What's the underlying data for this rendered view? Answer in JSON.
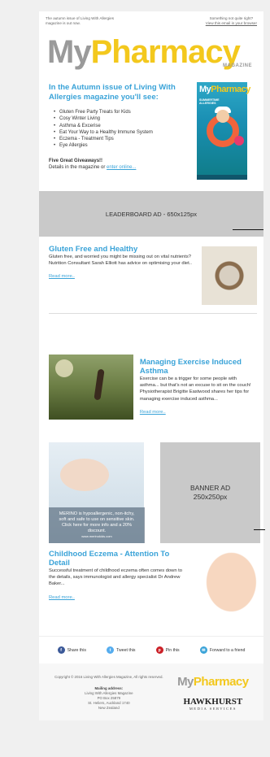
{
  "preheader": {
    "left": "The autumn issue of Living With Allergies magazine is out now.",
    "right_line1": "Something not quite right?",
    "right_link": "View this email in your browser"
  },
  "logo": {
    "my": "My",
    "pharmacy": "Pharmacy",
    "magazine": "MAGAZINE"
  },
  "intro": {
    "headline": "In the Autumn issue of Living With Allergies magazine you'll see:",
    "items": [
      "Gluten Free Party Treats for Kids",
      "Cosy Winter Living",
      "Asthma & Excerise",
      "Eat Your Way to a Healthy Immune System",
      "Eczema - Treatment Tips",
      "Eye Allergies"
    ],
    "giveaway_title": "Five Great Giveaways!!",
    "giveaway_text": "Details in the magazine or",
    "giveaway_link": "enter online..."
  },
  "cover": {
    "title_my": "My",
    "title_pharmacy": "Pharmacy",
    "subtitle": "SUMMERTIME ALLERGIES"
  },
  "leaderboard": {
    "label": "LEADERBOARD AD  -  650x125px"
  },
  "article1": {
    "title": "Gluten Free and Healthy",
    "body": "Gluten free, and worried you might be missing out on vital nutrients? Nutrition Consultant Sarah Elliott has advice on optimising your diet..",
    "link": "Read more.."
  },
  "article2": {
    "title": "Managing Exercise Induced Asthma",
    "body": "Exercise can be a trigger for some people with asthma... but that's not an excuse to sit on the couch! Physiotherapist Brigitte Eastwood shares her tips for managing exercise induced asthma...",
    "link": "Read more.."
  },
  "merino_ad": {
    "text": "MERINO is hypoallergenic, non-itchy, soft and safe to use on sensitive skin. Click here for more info and a 20% discount.",
    "url": "www.merinokids.com"
  },
  "banner": {
    "line1": "BANNER AD",
    "line2": "250x250px"
  },
  "article3": {
    "title": "Childhood Eczema - Attention To Detail",
    "body": "Successful treatment of childhood eczema often comes down to the details, says immunologist and allergy specialist Dr Andrew Baker...",
    "link": "Read more.."
  },
  "share": [
    {
      "label": "Share this",
      "icon": "facebook-icon",
      "color": "#3b5998",
      "glyph": "f"
    },
    {
      "label": "Tweet this",
      "icon": "twitter-icon",
      "color": "#55acee",
      "glyph": "t"
    },
    {
      "label": "Pin this",
      "icon": "pinterest-icon",
      "color": "#cb2027",
      "glyph": "p"
    },
    {
      "label": "Forward to a friend",
      "icon": "mail-icon",
      "color": "#3aa3d8",
      "glyph": "✉"
    }
  ],
  "footer": {
    "copyright": "Copyright © 2016 Living With Allergies Magazine, All rights reserved.",
    "mailing_title": "Mailing address:",
    "address": [
      "Living With Allergies Magazine",
      "PO Box 25879",
      "St. Heliers, Auckland 1740",
      "New Zealand"
    ],
    "logo_my": "My",
    "logo_pharmacy": "Pharmacy",
    "publisher": "HAWKHURST",
    "publisher_sub": "MEDIA SERVICES"
  },
  "colors": {
    "accent": "#3aa3d8",
    "brand_yellow": "#f3c81d",
    "brand_grey": "#9a9a9a",
    "ad_grey": "#c9c9c9"
  }
}
